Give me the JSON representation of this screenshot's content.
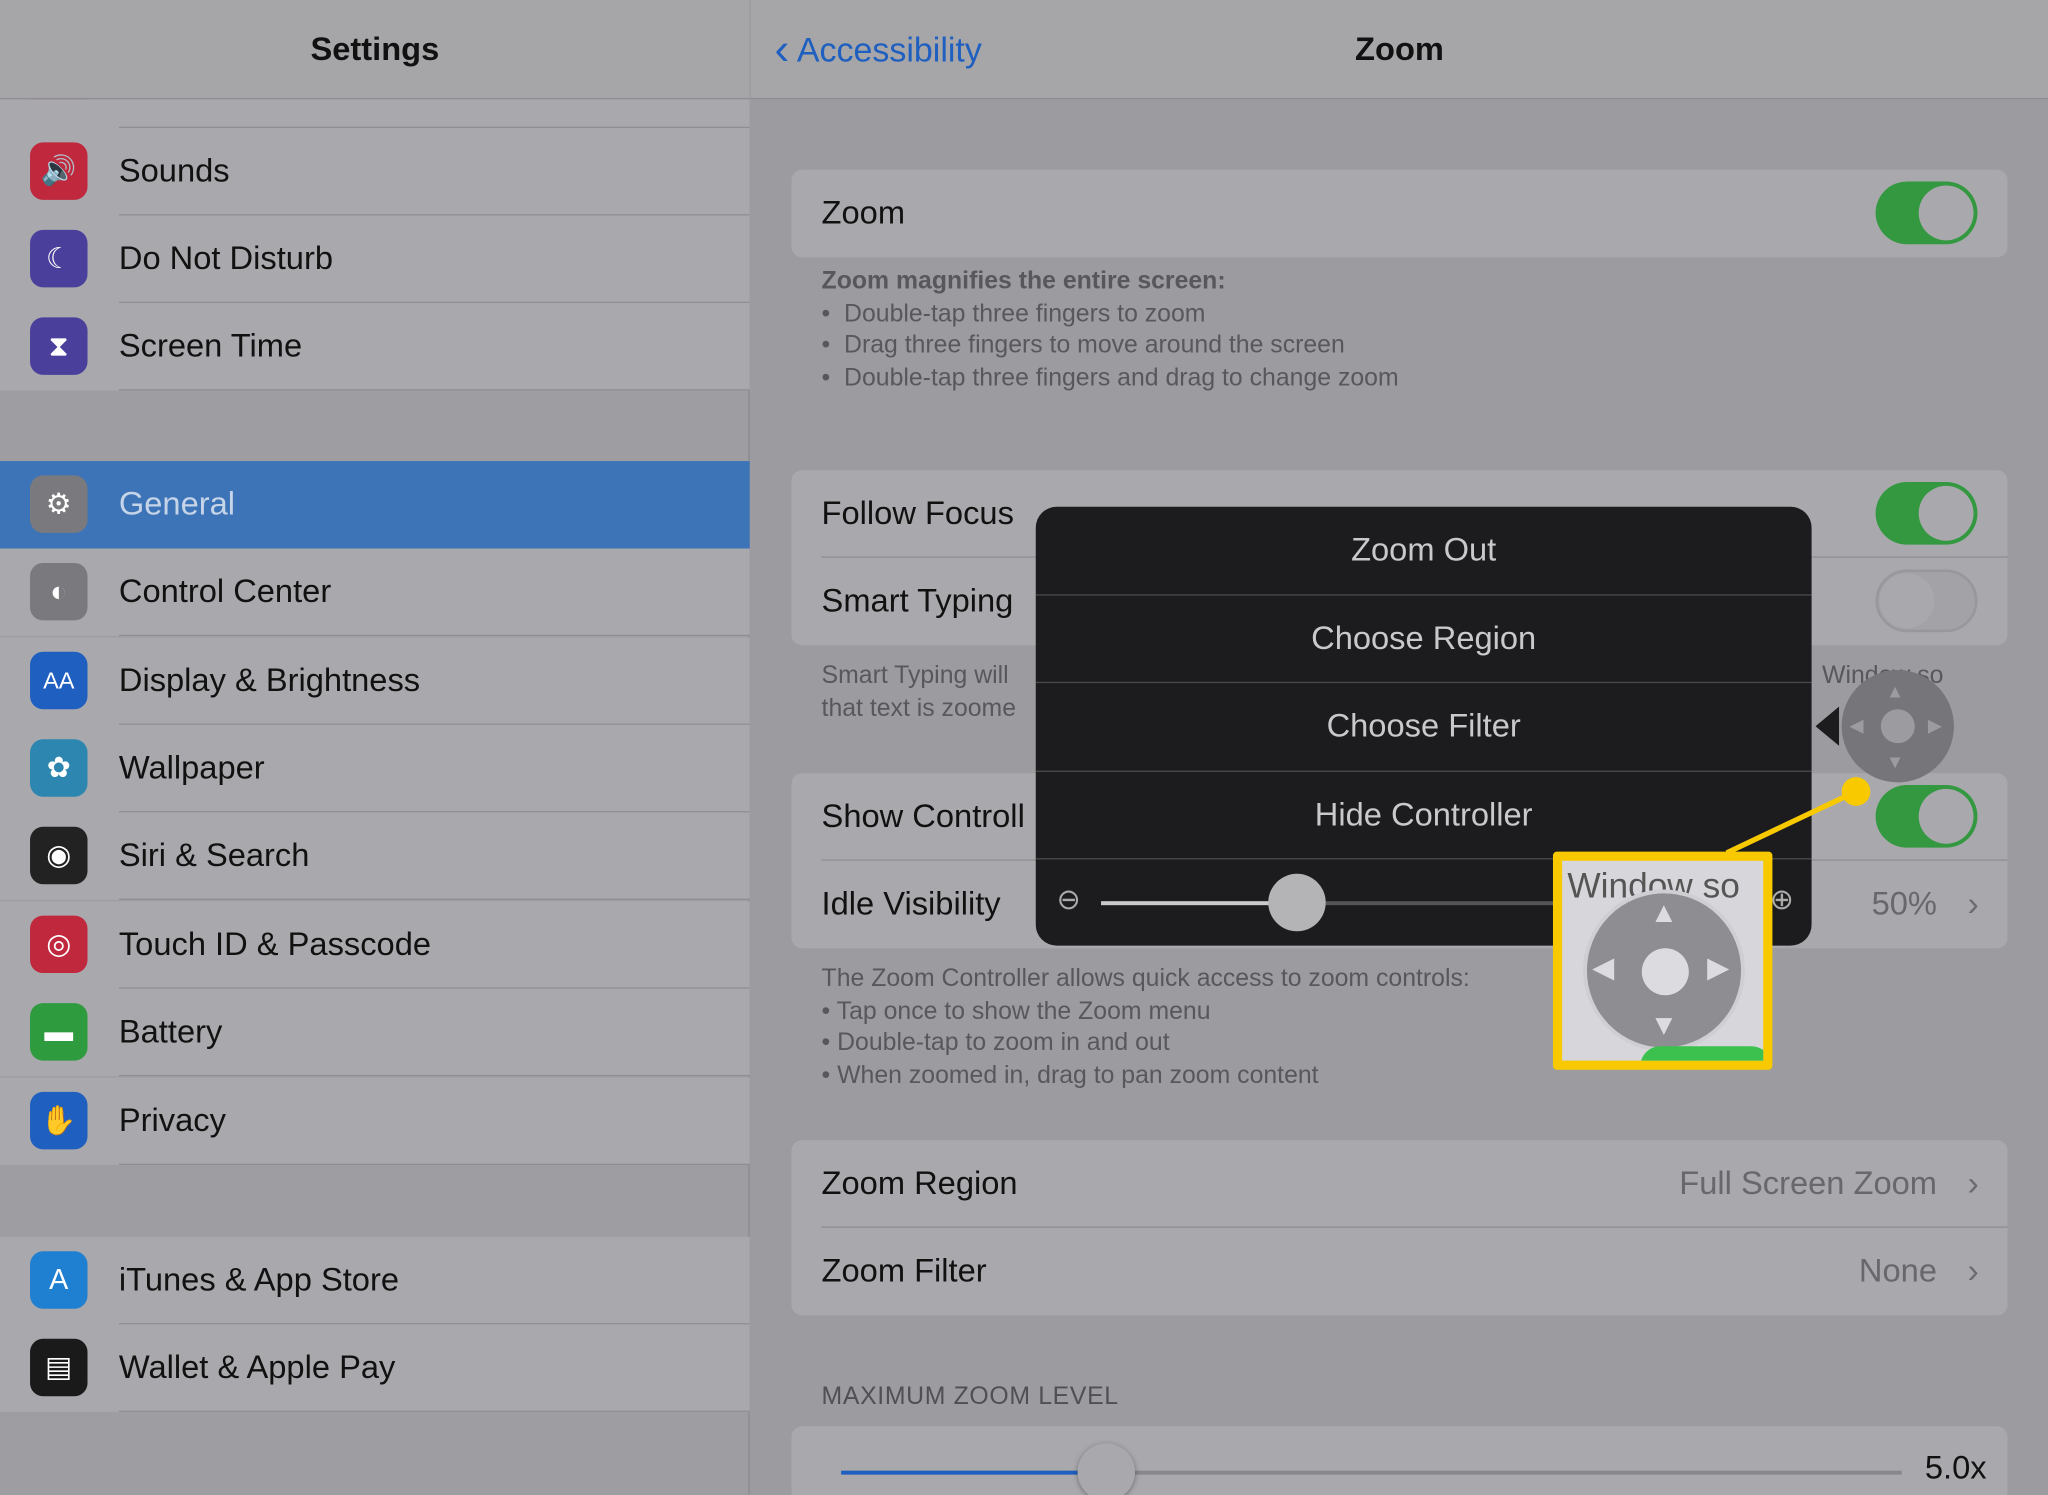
{
  "sidebar": {
    "title": "Settings",
    "items": [
      {
        "label": "Sounds",
        "icon": "speaker-icon",
        "color": "#c0283e"
      },
      {
        "label": "Do Not Disturb",
        "icon": "moon-icon",
        "color": "#4b3f9c"
      },
      {
        "label": "Screen Time",
        "icon": "hourglass-icon",
        "color": "#4b3f9c"
      },
      {
        "label": "General",
        "icon": "gear-icon",
        "color": "#7a7a7e",
        "selected": true
      },
      {
        "label": "Control Center",
        "icon": "toggles-icon",
        "color": "#7a7a7e"
      },
      {
        "label": "Display & Brightness",
        "icon": "text-size-icon",
        "color": "#1f5fbf"
      },
      {
        "label": "Wallpaper",
        "icon": "flower-icon",
        "color": "#2d86b0"
      },
      {
        "label": "Siri & Search",
        "icon": "siri-icon",
        "color": "#222"
      },
      {
        "label": "Touch ID & Passcode",
        "icon": "fingerprint-icon",
        "color": "#c0283e"
      },
      {
        "label": "Battery",
        "icon": "battery-icon",
        "color": "#2e9c3e"
      },
      {
        "label": "Privacy",
        "icon": "hand-icon",
        "color": "#1f5fbf"
      },
      {
        "label": "iTunes & App Store",
        "icon": "app-store-icon",
        "color": "#1f7fd0"
      },
      {
        "label": "Wallet & Apple Pay",
        "icon": "wallet-icon",
        "color": "#1a1a1a"
      }
    ]
  },
  "header": {
    "back": "Accessibility",
    "title": "Zoom"
  },
  "zoom": {
    "label": "Zoom",
    "on": true,
    "footer_title": "Zoom magnifies the entire screen:",
    "footer": [
      "Double-tap three fingers to zoom",
      "Drag three fingers to move around the screen",
      "Double-tap three fingers and drag to change zoom"
    ]
  },
  "focus": {
    "follow": "Follow Focus",
    "follow_on": true,
    "smart": "Smart Typing",
    "smart_on": false,
    "footer1a": "Smart Typing will",
    "footer1b": "Window so",
    "footer2": "that text is zoome"
  },
  "controller": {
    "show": "Show Controll",
    "show_on": true,
    "idle": "Idle Visibility",
    "idle_value": "50%",
    "footer": [
      "The Zoom Controller allows quick access to zoom controls:",
      "• Tap once to show the Zoom menu",
      "• Double-tap to zoom in and out",
      "• When zoomed in, drag to pan zoom content"
    ]
  },
  "region": {
    "label": "Zoom Region",
    "value": "Full Screen Zoom"
  },
  "filter": {
    "label": "Zoom Filter",
    "value": "None"
  },
  "max": {
    "header": "MAXIMUM ZOOM LEVEL",
    "value": "5.0x",
    "fraction": 0.25
  },
  "popup": {
    "items": [
      "Zoom Out",
      "Choose Region",
      "Choose Filter",
      "Hide Controller"
    ],
    "slider_fraction": 0.3
  },
  "callout": {
    "text": "Window so",
    "color": "#f9c900"
  }
}
